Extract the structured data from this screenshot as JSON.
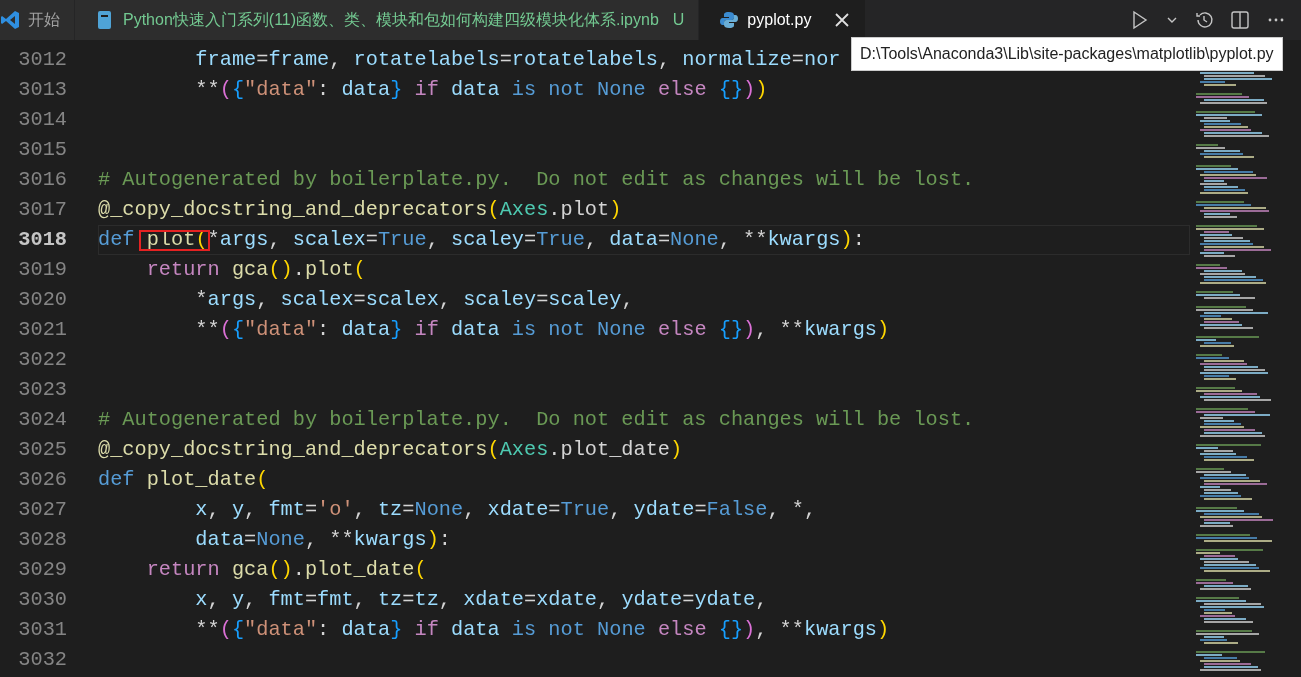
{
  "tabs": [
    {
      "label": "开始",
      "selected": false,
      "untracked": false
    },
    {
      "label": "Python快速入门系列(11)函数、类、模块和包如何构建四级模块化体系.ipynb",
      "status": "U",
      "selected": false,
      "untracked": true
    },
    {
      "label": "pyplot.py",
      "selected": true,
      "untracked": false,
      "closable": true
    }
  ],
  "tooltip": "D:\\Tools\\Anaconda3\\Lib\\site-packages\\matplotlib\\pyplot.py",
  "lines": [
    {
      "number": "3012",
      "current": false,
      "tokens": [
        {
          "kind": "var",
          "text": "        frame"
        },
        {
          "kind": "plain",
          "text": "="
        },
        {
          "kind": "var",
          "text": "frame"
        },
        {
          "kind": "plain",
          "text": ", "
        },
        {
          "kind": "var",
          "text": "rotatelabels"
        },
        {
          "kind": "plain",
          "text": "="
        },
        {
          "kind": "var",
          "text": "rotatelabels"
        },
        {
          "kind": "plain",
          "text": ", "
        },
        {
          "kind": "var",
          "text": "normalize"
        },
        {
          "kind": "plain",
          "text": "="
        },
        {
          "kind": "var",
          "text": "nor"
        }
      ]
    },
    {
      "number": "3013",
      "current": false,
      "tokens": [
        {
          "kind": "plain",
          "text": "        **"
        },
        {
          "kind": "bracket2",
          "text": "("
        },
        {
          "kind": "bracket3",
          "text": "{"
        },
        {
          "kind": "string",
          "text": "\"data\""
        },
        {
          "kind": "plain",
          "text": ": "
        },
        {
          "kind": "var",
          "text": "data"
        },
        {
          "kind": "bracket3",
          "text": "} "
        },
        {
          "kind": "control",
          "text": "if "
        },
        {
          "kind": "var",
          "text": "data "
        },
        {
          "kind": "keyword",
          "text": "is "
        },
        {
          "kind": "keyword",
          "text": "not "
        },
        {
          "kind": "keyword",
          "text": "None "
        },
        {
          "kind": "control",
          "text": "else "
        },
        {
          "kind": "bracket3",
          "text": "{}"
        },
        {
          "kind": "bracket2",
          "text": ")"
        },
        {
          "kind": "bracket1",
          "text": ")"
        }
      ]
    },
    {
      "number": "3014",
      "current": false
    },
    {
      "number": "3015",
      "current": false
    },
    {
      "number": "3016",
      "current": false,
      "tokens": [
        {
          "kind": "comment",
          "text": "# Autogenerated by boilerplate.py.  Do not edit as changes will be lost."
        }
      ]
    },
    {
      "number": "3017",
      "current": false,
      "tokens": [
        {
          "kind": "func",
          "text": "@_copy_docstring_and_deprecators"
        },
        {
          "kind": "bracket1",
          "text": "("
        },
        {
          "kind": "class",
          "text": "Axes"
        },
        {
          "kind": "plain",
          "text": ".plot"
        },
        {
          "kind": "bracket1",
          "text": ")"
        }
      ]
    },
    {
      "number": "3018",
      "current": true,
      "tokens": [
        {
          "kind": "keyword",
          "text": "def "
        },
        {
          "kind": "func",
          "text": "plot",
          "boxed": true
        },
        {
          "kind": "bracket1",
          "text": "(",
          "boxed": true
        },
        {
          "kind": "plain",
          "text": "*"
        },
        {
          "kind": "var",
          "text": "args"
        },
        {
          "kind": "plain",
          "text": ", "
        },
        {
          "kind": "var",
          "text": "scalex"
        },
        {
          "kind": "plain",
          "text": "="
        },
        {
          "kind": "keyword",
          "text": "True"
        },
        {
          "kind": "plain",
          "text": ", "
        },
        {
          "kind": "var",
          "text": "scaley"
        },
        {
          "kind": "plain",
          "text": "="
        },
        {
          "kind": "keyword",
          "text": "True"
        },
        {
          "kind": "plain",
          "text": ", "
        },
        {
          "kind": "var",
          "text": "data"
        },
        {
          "kind": "plain",
          "text": "="
        },
        {
          "kind": "keyword",
          "text": "None"
        },
        {
          "kind": "plain",
          "text": ", **"
        },
        {
          "kind": "var",
          "text": "kwargs"
        },
        {
          "kind": "bracket1",
          "text": ")"
        },
        {
          "kind": "plain",
          "text": ":"
        }
      ]
    },
    {
      "number": "3019",
      "current": false,
      "tokens": [
        {
          "kind": "control",
          "text": "    return "
        },
        {
          "kind": "func",
          "text": "gca"
        },
        {
          "kind": "bracket1",
          "text": "()"
        },
        {
          "kind": "plain",
          "text": "."
        },
        {
          "kind": "func",
          "text": "plot"
        },
        {
          "kind": "bracket1",
          "text": "("
        }
      ]
    },
    {
      "number": "3020",
      "current": false,
      "tokens": [
        {
          "kind": "plain",
          "text": "        *"
        },
        {
          "kind": "var",
          "text": "args"
        },
        {
          "kind": "plain",
          "text": ", "
        },
        {
          "kind": "var",
          "text": "scalex"
        },
        {
          "kind": "plain",
          "text": "="
        },
        {
          "kind": "var",
          "text": "scalex"
        },
        {
          "kind": "plain",
          "text": ", "
        },
        {
          "kind": "var",
          "text": "scaley"
        },
        {
          "kind": "plain",
          "text": "="
        },
        {
          "kind": "var",
          "text": "scaley"
        },
        {
          "kind": "plain",
          "text": ","
        }
      ]
    },
    {
      "number": "3021",
      "current": false,
      "tokens": [
        {
          "kind": "plain",
          "text": "        **"
        },
        {
          "kind": "bracket2",
          "text": "("
        },
        {
          "kind": "bracket3",
          "text": "{"
        },
        {
          "kind": "string",
          "text": "\"data\""
        },
        {
          "kind": "plain",
          "text": ": "
        },
        {
          "kind": "var",
          "text": "data"
        },
        {
          "kind": "bracket3",
          "text": "} "
        },
        {
          "kind": "control",
          "text": "if "
        },
        {
          "kind": "var",
          "text": "data "
        },
        {
          "kind": "keyword",
          "text": "is "
        },
        {
          "kind": "keyword",
          "text": "not "
        },
        {
          "kind": "keyword",
          "text": "None "
        },
        {
          "kind": "control",
          "text": "else "
        },
        {
          "kind": "bracket3",
          "text": "{}"
        },
        {
          "kind": "bracket2",
          "text": ")"
        },
        {
          "kind": "plain",
          "text": ", **"
        },
        {
          "kind": "var",
          "text": "kwargs"
        },
        {
          "kind": "bracket1",
          "text": ")"
        }
      ]
    },
    {
      "number": "3022",
      "current": false
    },
    {
      "number": "3023",
      "current": false
    },
    {
      "number": "3024",
      "current": false,
      "tokens": [
        {
          "kind": "comment",
          "text": "# Autogenerated by boilerplate.py.  Do not edit as changes will be lost."
        }
      ]
    },
    {
      "number": "3025",
      "current": false,
      "tokens": [
        {
          "kind": "func",
          "text": "@_copy_docstring_and_deprecators"
        },
        {
          "kind": "bracket1",
          "text": "("
        },
        {
          "kind": "class",
          "text": "Axes"
        },
        {
          "kind": "plain",
          "text": ".plot_date"
        },
        {
          "kind": "bracket1",
          "text": ")"
        }
      ]
    },
    {
      "number": "3026",
      "current": false,
      "tokens": [
        {
          "kind": "keyword",
          "text": "def "
        },
        {
          "kind": "func",
          "text": "plot_date"
        },
        {
          "kind": "bracket1",
          "text": "("
        }
      ]
    },
    {
      "number": "3027",
      "current": false,
      "tokens": [
        {
          "kind": "var",
          "text": "        x"
        },
        {
          "kind": "plain",
          "text": ", "
        },
        {
          "kind": "var",
          "text": "y"
        },
        {
          "kind": "plain",
          "text": ", "
        },
        {
          "kind": "var",
          "text": "fmt"
        },
        {
          "kind": "plain",
          "text": "="
        },
        {
          "kind": "string",
          "text": "'o'"
        },
        {
          "kind": "plain",
          "text": ", "
        },
        {
          "kind": "var",
          "text": "tz"
        },
        {
          "kind": "plain",
          "text": "="
        },
        {
          "kind": "keyword",
          "text": "None"
        },
        {
          "kind": "plain",
          "text": ", "
        },
        {
          "kind": "var",
          "text": "xdate"
        },
        {
          "kind": "plain",
          "text": "="
        },
        {
          "kind": "keyword",
          "text": "True"
        },
        {
          "kind": "plain",
          "text": ", "
        },
        {
          "kind": "var",
          "text": "ydate"
        },
        {
          "kind": "plain",
          "text": "="
        },
        {
          "kind": "keyword",
          "text": "False"
        },
        {
          "kind": "plain",
          "text": ", *,"
        }
      ]
    },
    {
      "number": "3028",
      "current": false,
      "tokens": [
        {
          "kind": "var",
          "text": "        data"
        },
        {
          "kind": "plain",
          "text": "="
        },
        {
          "kind": "keyword",
          "text": "None"
        },
        {
          "kind": "plain",
          "text": ", **"
        },
        {
          "kind": "var",
          "text": "kwargs"
        },
        {
          "kind": "bracket1",
          "text": ")"
        },
        {
          "kind": "plain",
          "text": ":"
        }
      ]
    },
    {
      "number": "3029",
      "current": false,
      "tokens": [
        {
          "kind": "control",
          "text": "    return "
        },
        {
          "kind": "func",
          "text": "gca"
        },
        {
          "kind": "bracket1",
          "text": "()"
        },
        {
          "kind": "plain",
          "text": "."
        },
        {
          "kind": "func",
          "text": "plot_date"
        },
        {
          "kind": "bracket1",
          "text": "("
        }
      ]
    },
    {
      "number": "3030",
      "current": false,
      "tokens": [
        {
          "kind": "var",
          "text": "        x"
        },
        {
          "kind": "plain",
          "text": ", "
        },
        {
          "kind": "var",
          "text": "y"
        },
        {
          "kind": "plain",
          "text": ", "
        },
        {
          "kind": "var",
          "text": "fmt"
        },
        {
          "kind": "plain",
          "text": "="
        },
        {
          "kind": "var",
          "text": "fmt"
        },
        {
          "kind": "plain",
          "text": ", "
        },
        {
          "kind": "var",
          "text": "tz"
        },
        {
          "kind": "plain",
          "text": "="
        },
        {
          "kind": "var",
          "text": "tz"
        },
        {
          "kind": "plain",
          "text": ", "
        },
        {
          "kind": "var",
          "text": "xdate"
        },
        {
          "kind": "plain",
          "text": "="
        },
        {
          "kind": "var",
          "text": "xdate"
        },
        {
          "kind": "plain",
          "text": ", "
        },
        {
          "kind": "var",
          "text": "ydate"
        },
        {
          "kind": "plain",
          "text": "="
        },
        {
          "kind": "var",
          "text": "ydate"
        },
        {
          "kind": "plain",
          "text": ","
        }
      ]
    },
    {
      "number": "3031",
      "current": false,
      "tokens": [
        {
          "kind": "plain",
          "text": "        **"
        },
        {
          "kind": "bracket2",
          "text": "("
        },
        {
          "kind": "bracket3",
          "text": "{"
        },
        {
          "kind": "string",
          "text": "\"data\""
        },
        {
          "kind": "plain",
          "text": ": "
        },
        {
          "kind": "var",
          "text": "data"
        },
        {
          "kind": "bracket3",
          "text": "} "
        },
        {
          "kind": "control",
          "text": "if "
        },
        {
          "kind": "var",
          "text": "data "
        },
        {
          "kind": "keyword",
          "text": "is "
        },
        {
          "kind": "keyword",
          "text": "not "
        },
        {
          "kind": "keyword",
          "text": "None "
        },
        {
          "kind": "control",
          "text": "else "
        },
        {
          "kind": "bracket3",
          "text": "{}"
        },
        {
          "kind": "bracket2",
          "text": ")"
        },
        {
          "kind": "plain",
          "text": ", **"
        },
        {
          "kind": "var",
          "text": "kwargs"
        },
        {
          "kind": "bracket1",
          "text": ")"
        }
      ]
    },
    {
      "number": "3032",
      "current": false
    }
  ]
}
